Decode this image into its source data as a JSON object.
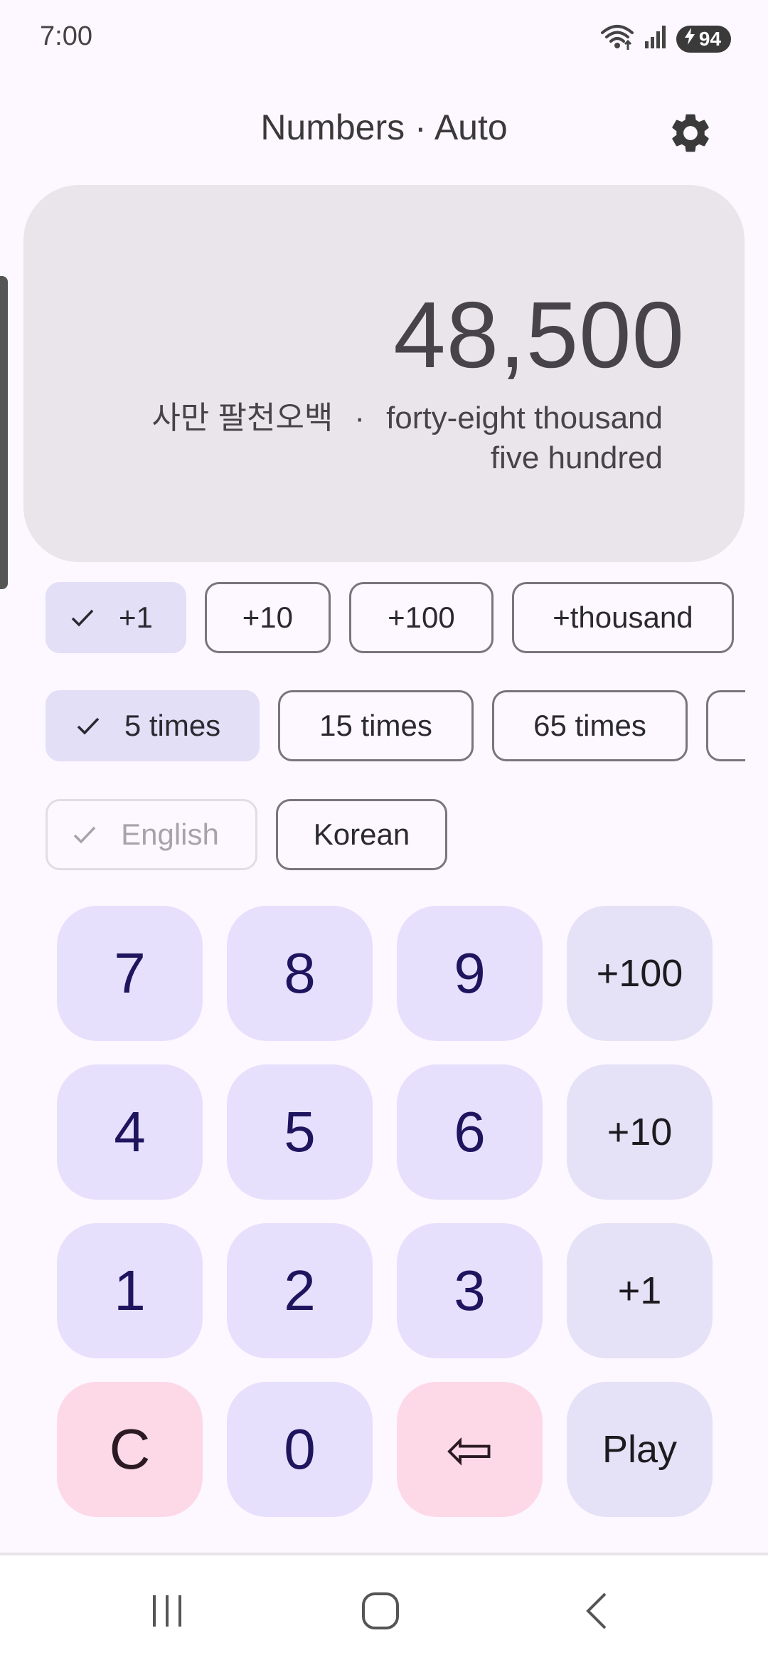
{
  "status_bar": {
    "time": "7:00",
    "battery": "94",
    "icons": [
      "wifi-icon",
      "signal-icon",
      "battery-charging-icon"
    ]
  },
  "app_bar": {
    "title": "Numbers · Auto",
    "settings_icon": "gear-icon"
  },
  "display": {
    "number": "48,500",
    "korean": "사만 팔천오백",
    "separator": "·",
    "english_line1": "forty-eight thousand",
    "english_line2": "five hundred"
  },
  "step_chips": [
    {
      "label": "+1",
      "selected": true
    },
    {
      "label": "+10",
      "selected": false
    },
    {
      "label": "+100",
      "selected": false
    },
    {
      "label": "+thousand",
      "selected": false
    }
  ],
  "repeat_chips": [
    {
      "label": "5 times",
      "selected": true
    },
    {
      "label": "15 times",
      "selected": false
    },
    {
      "label": "65 times",
      "selected": false
    },
    {
      "label": "",
      "selected": false
    }
  ],
  "language_chips": [
    {
      "label": "English",
      "selected": true,
      "disabled": true
    },
    {
      "label": "Korean",
      "selected": false
    }
  ],
  "keypad": {
    "keys": [
      "7",
      "8",
      "9",
      "+100",
      "4",
      "5",
      "6",
      "+10",
      "1",
      "2",
      "3",
      "+1",
      "C",
      "0",
      "⇦",
      "Play"
    ]
  },
  "colors": {
    "background": "#fdf7ff",
    "display_card": "#e9e5ea",
    "selected_chip": "#e2dff6",
    "digit_key": "#e6e0fd",
    "digit_text": "#1f155e",
    "op_key": "#e5e1f6",
    "danger_key": "#fdd9e8"
  },
  "nav_bar": {
    "icons": [
      "recents-icon",
      "home-icon",
      "back-icon"
    ]
  }
}
